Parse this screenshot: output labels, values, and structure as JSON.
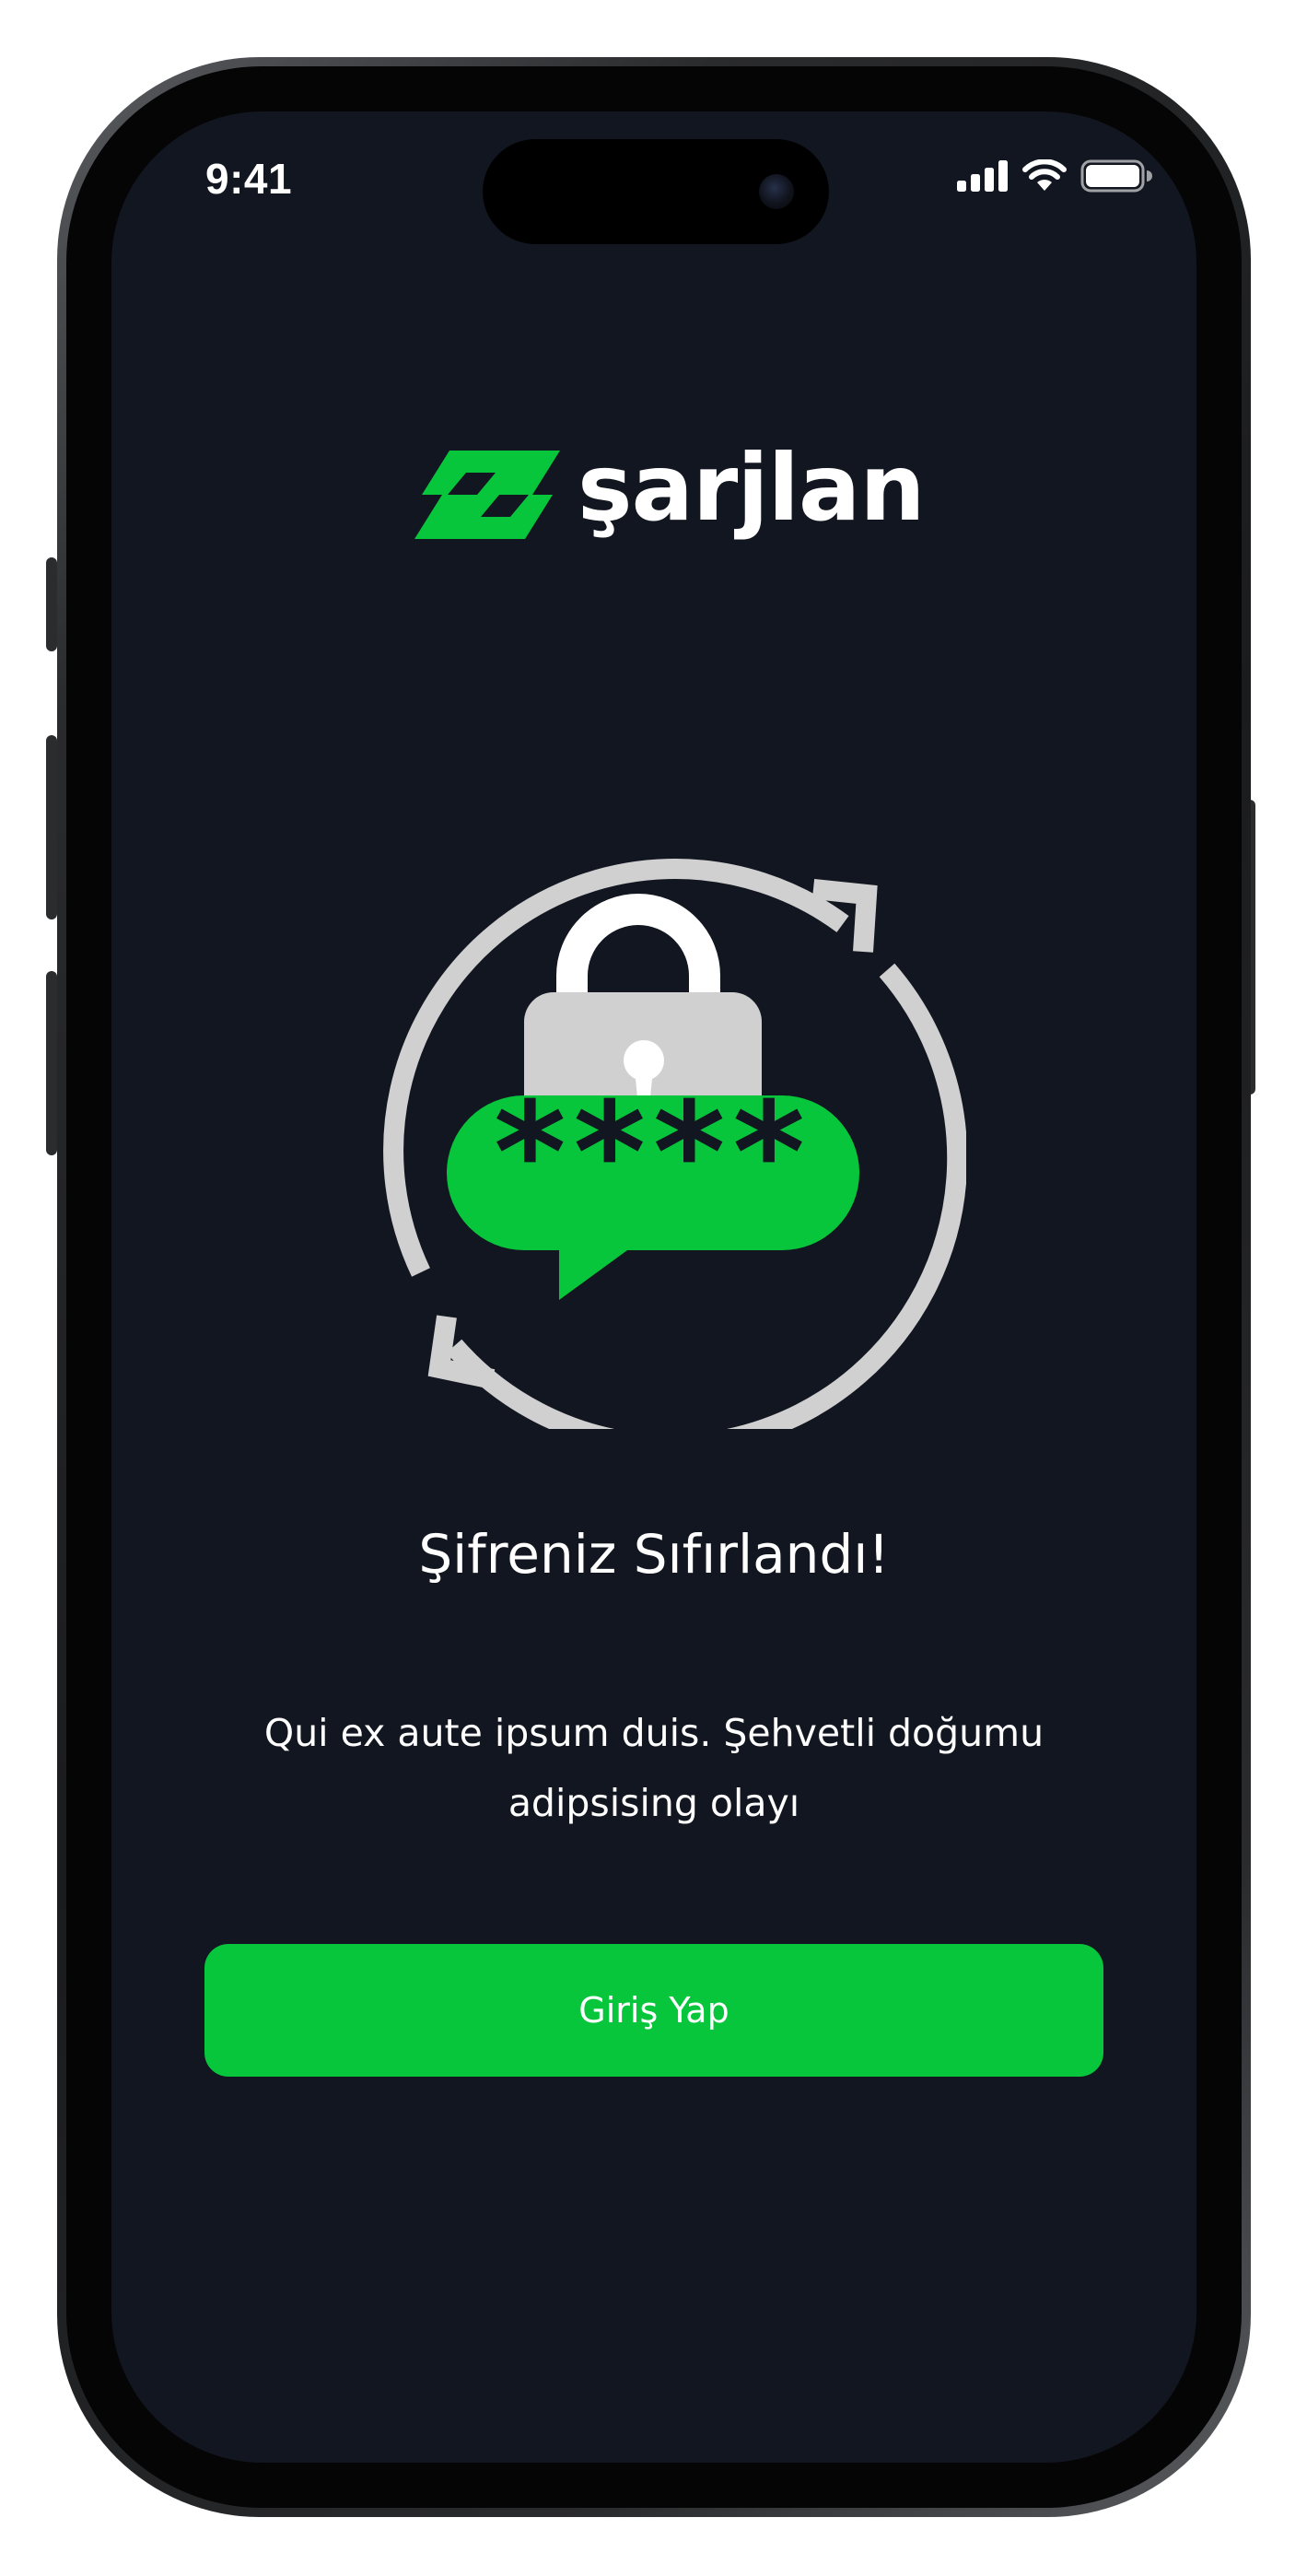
{
  "status_bar": {
    "time": "9:41",
    "signal_icon": "cellular-signal-icon",
    "wifi_icon": "wifi-icon",
    "battery_icon": "battery-icon"
  },
  "brand": {
    "name": "şarjlan",
    "logo_icon": "lightning-bolt-logo-icon",
    "accent_color": "#07c63c"
  },
  "illustration": {
    "icon": "password-reset-lock-icon",
    "masked_password": "****"
  },
  "content": {
    "title": "Şifreniz Sıfırlandı!",
    "description": "Qui ex aute ipsum duis. Şehvetli doğumu adipsising olayı"
  },
  "actions": {
    "login_label": "Giriş Yap"
  },
  "theme": {
    "background": "#121620",
    "text": "#ffffff",
    "neutral_graphic": "#d0d0d0"
  }
}
